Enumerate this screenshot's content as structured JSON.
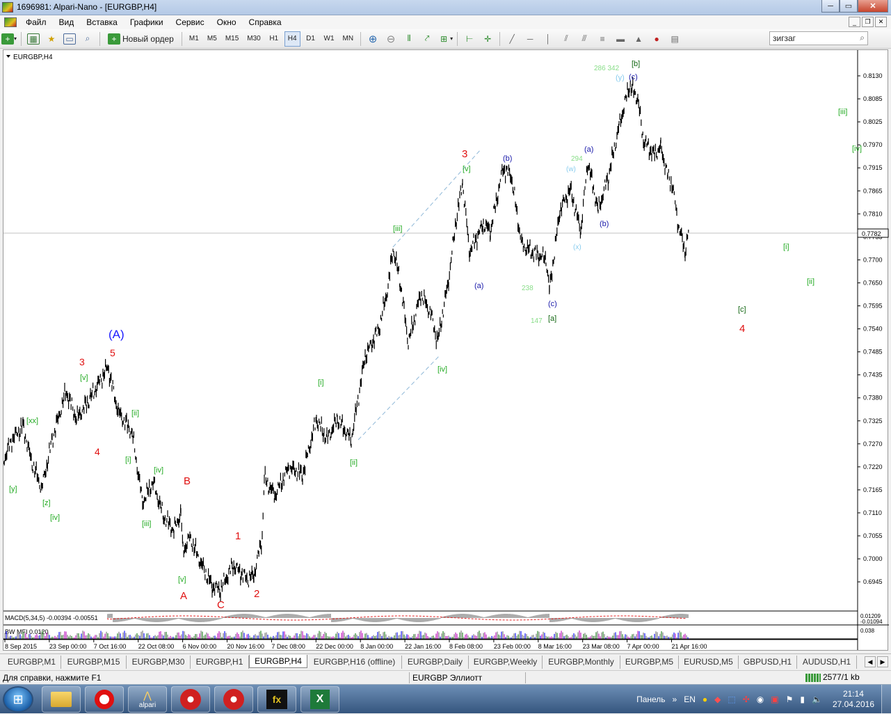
{
  "window": {
    "title": "1696981: Alpari-Nano - [EURGBP,H4]",
    "btn_min": "─",
    "btn_max": "▭",
    "btn_close": "✕"
  },
  "menu": [
    "Файл",
    "Вид",
    "Вставка",
    "Графики",
    "Сервис",
    "Окно",
    "Справка"
  ],
  "mdi_buttons": [
    "_",
    "❐",
    "✕"
  ],
  "toolbar": {
    "new_order": "Новый ордер",
    "timeframes": [
      "M1",
      "M5",
      "M15",
      "M30",
      "H1",
      "H4",
      "D1",
      "W1",
      "MN"
    ],
    "active_timeframe": "H4",
    "search_value": "зигзаг"
  },
  "chart": {
    "symbol_label": "EURGBP,H4",
    "current_price": "0.7782",
    "price_ticks": [
      "0.8130",
      "0.8085",
      "0.8025",
      "0.7970",
      "0.7915",
      "0.7865",
      "0.7810",
      "0.7755",
      "0.7700",
      "0.7650",
      "0.7595",
      "0.7540",
      "0.7485",
      "0.7435",
      "0.7380",
      "0.7325",
      "0.7270",
      "0.7220",
      "0.7165",
      "0.7110",
      "0.7055",
      "0.7000",
      "0.6945"
    ],
    "date_ticks": [
      "8 Sep 2015",
      "23 Sep 00:00",
      "7 Oct 16:00",
      "22 Oct 08:00",
      "6 Nov 00:00",
      "20 Nov 16:00",
      "7 Dec 08:00",
      "22 Dec 00:00",
      "8 Jan 00:00",
      "22 Jan 16:00",
      "8 Feb 08:00",
      "23 Feb 00:00",
      "8 Mar 16:00",
      "23 Mar 08:00",
      "7 Apr 00:00",
      "21 Apr 16:00"
    ],
    "macd_label": "MACD(5,34,5) -0.00394 -0.00551",
    "macd_scale_top": "0.01209",
    "macd_scale_bottom": "-0.01094",
    "mfi_label": "BW MFI 0.0120",
    "mfi_scale": "0.038",
    "labels": [
      {
        "t": "(A)",
        "c": "#1a1aff"
      },
      {
        "t": "5",
        "c": "#e01010"
      },
      {
        "t": "3",
        "c": "#e01010"
      },
      {
        "t": "4",
        "c": "#e01010"
      },
      {
        "t": "[v]",
        "c": "#22aa22"
      },
      {
        "t": "[xx]",
        "c": "#22aa22"
      },
      {
        "t": "[y]",
        "c": "#22aa22"
      },
      {
        "t": "[z]",
        "c": "#22aa22"
      },
      {
        "t": "[iv]",
        "c": "#22aa22"
      },
      {
        "t": "[ii]",
        "c": "#22aa22"
      },
      {
        "t": "[i]",
        "c": "#22aa22"
      },
      {
        "t": "[iv]",
        "c": "#22aa22"
      },
      {
        "t": "[iii]",
        "c": "#22aa22"
      },
      {
        "t": "B",
        "c": "#e01010"
      },
      {
        "t": "[v]",
        "c": "#22aa22"
      },
      {
        "t": "A",
        "c": "#e01010"
      },
      {
        "t": "C",
        "c": "#e01010"
      },
      {
        "t": "1",
        "c": "#e01010"
      },
      {
        "t": "2",
        "c": "#e01010"
      },
      {
        "t": "[i]",
        "c": "#22aa22"
      },
      {
        "t": "[ii]",
        "c": "#22aa22"
      },
      {
        "t": "[iii]",
        "c": "#22aa22"
      },
      {
        "t": "3",
        "c": "#e01010"
      },
      {
        "t": "[v]",
        "c": "#22aa22"
      },
      {
        "t": "[iv]",
        "c": "#22aa22"
      },
      {
        "t": "(a)",
        "c": "#1a1aaa"
      },
      {
        "t": "(b)",
        "c": "#1a1aaa"
      },
      {
        "t": "238",
        "c": "#88dd88"
      },
      {
        "t": "147",
        "c": "#88dd88"
      },
      {
        "t": "(c)",
        "c": "#1a1aaa"
      },
      {
        "t": "[a]",
        "c": "#116611"
      },
      {
        "t": "(w)",
        "c": "#88ccee"
      },
      {
        "t": "294",
        "c": "#88dd88"
      },
      {
        "t": "(a)",
        "c": "#1a1aaa"
      },
      {
        "t": "(b)",
        "c": "#1a1aaa"
      },
      {
        "t": "(x)",
        "c": "#88ccee"
      },
      {
        "t": "286 342",
        "c": "#88dd88"
      },
      {
        "t": "(y)",
        "c": "#88ccee"
      },
      {
        "t": "(c)",
        "c": "#1a1aaa"
      },
      {
        "t": "[b]",
        "c": "#116611"
      },
      {
        "t": "[iii]",
        "c": "#22aa22"
      },
      {
        "t": "[iv]",
        "c": "#22aa22"
      },
      {
        "t": "[i]",
        "c": "#22aa22"
      },
      {
        "t": "[ii]",
        "c": "#22aa22"
      },
      {
        "t": "[c]",
        "c": "#116611"
      },
      {
        "t": "4",
        "c": "#e01010"
      }
    ]
  },
  "tabs": [
    "EURGBP,M1",
    "EURGBP,M15",
    "EURGBP,M30",
    "EURGBP,H1",
    "EURGBP,H4",
    "EURGBP,H16 (offline)",
    "EURGBP,Daily",
    "EURGBP,Weekly",
    "EURGBP,Monthly",
    "EURGBP,M5",
    "EURUSD,M5",
    "GBPUSD,H1",
    "AUDUSD,H1"
  ],
  "active_tab": "EURGBP,H4",
  "status": {
    "help": "Для справки, нажмите F1",
    "profile": "EURGBP Эллиотт",
    "connection": "2577/1 kb"
  },
  "taskbar": {
    "apps": [
      "folder",
      "opera",
      "alpari",
      "app-red-1",
      "app-red-2",
      "fx",
      "excel"
    ],
    "alpari_label": "alpari",
    "panel": "Панель",
    "lang": "EN",
    "time": "21:14",
    "date": "27.04.2016"
  }
}
